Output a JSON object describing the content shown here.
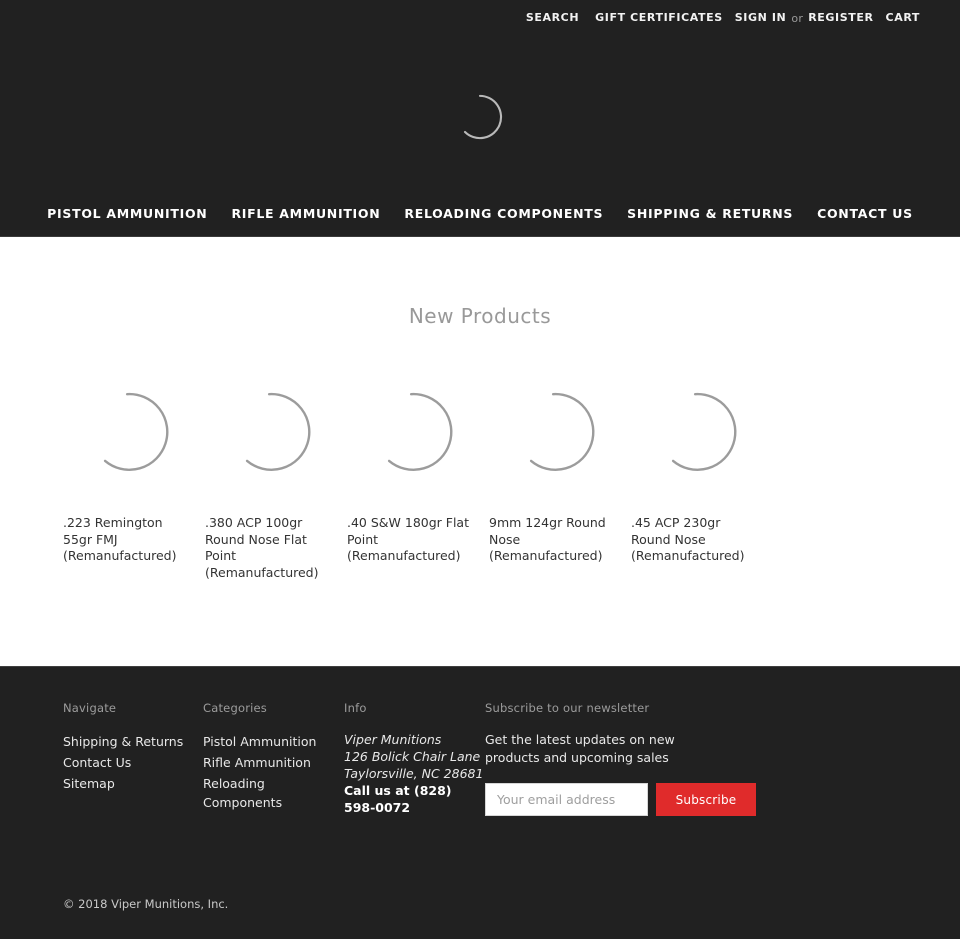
{
  "header": {
    "top_nav": [
      {
        "label": "SEARCH",
        "name": "search"
      },
      {
        "label": "GIFT CERTIFICATES",
        "name": "gift-certificates"
      },
      {
        "label": "SIGN IN",
        "name": "sign-in"
      },
      {
        "label": "or",
        "name": "or-separator"
      },
      {
        "label": "REGISTER",
        "name": "register"
      },
      {
        "label": "CART",
        "name": "cart"
      }
    ],
    "logo_spinner_icon": "loading-spinner-icon",
    "main_nav": [
      {
        "label": "PISTOL AMMUNITION"
      },
      {
        "label": "RIFLE AMMUNITION"
      },
      {
        "label": "RELOADING COMPONENTS"
      },
      {
        "label": "SHIPPING & RETURNS"
      },
      {
        "label": "CONTACT US"
      }
    ]
  },
  "main": {
    "section_title": "New Products",
    "products": [
      {
        "title": ".223 Remington 55gr FMJ (Remanufactured)",
        "image_icon": "loading-spinner-icon"
      },
      {
        "title": ".380 ACP 100gr Round Nose Flat Point (Remanufactured)",
        "image_icon": "loading-spinner-icon"
      },
      {
        "title": ".40 S&W 180gr Flat Point (Remanufactured)",
        "image_icon": "loading-spinner-icon"
      },
      {
        "title": "9mm 124gr Round Nose (Remanufactured)",
        "image_icon": "loading-spinner-icon"
      },
      {
        "title": ".45 ACP 230gr Round Nose (Remanufactured)",
        "image_icon": "loading-spinner-icon"
      }
    ]
  },
  "footer": {
    "navigate": {
      "heading": "Navigate",
      "items": [
        {
          "label": "Shipping & Returns"
        },
        {
          "label": "Contact Us"
        },
        {
          "label": "Sitemap"
        }
      ]
    },
    "categories": {
      "heading": "Categories",
      "items": [
        {
          "label": "Pistol Ammunition"
        },
        {
          "label": "Rifle Ammunition"
        },
        {
          "label": "Reloading Components"
        }
      ]
    },
    "info": {
      "heading": "Info",
      "company": "Viper Munitions",
      "address_line1": "126 Bolick Chair Lane",
      "address_line2": "Taylorsville, NC 28681",
      "phone": "Call us at (828) 598-0072"
    },
    "subscribe": {
      "heading": "Subscribe to our newsletter",
      "description": "Get the latest updates on new products and upcoming sales",
      "email_placeholder": "Your email address",
      "email_value": "",
      "button_label": "Subscribe",
      "button_color": "#e02b2b"
    },
    "copyright": "© 2018 Viper Munitions, Inc."
  },
  "colors": {
    "dark_bg": "#212121",
    "accent_red": "#e02b2b",
    "heading_gray": "#999999"
  }
}
